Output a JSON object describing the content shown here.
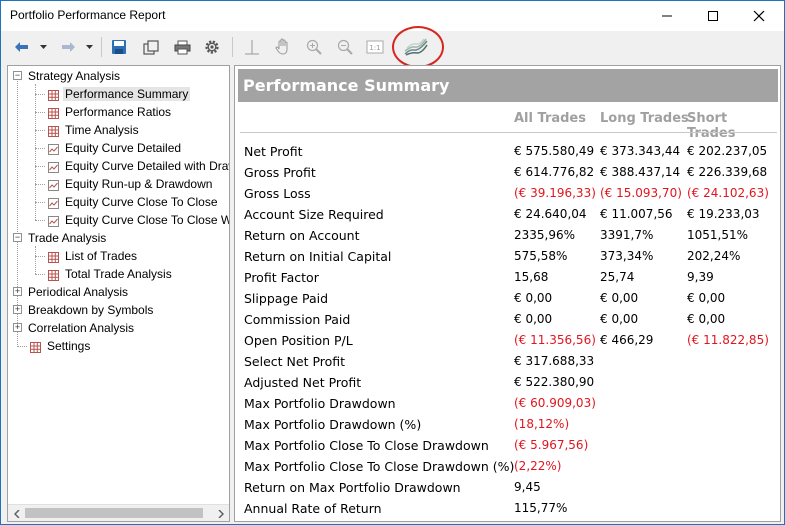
{
  "window": {
    "title": "Portfolio Performance Report"
  },
  "toolbar": {
    "icons": [
      "back-arrow-icon",
      "dropdown-icon",
      "forward-arrow-icon",
      "dropdown-icon",
      "save-icon",
      "export-icon",
      "print-icon",
      "settings-gear-icon",
      "crosshair-icon",
      "hand-pan-icon",
      "zoom-in-icon",
      "zoom-out-icon",
      "zoom-fit-icon",
      "equity-curve-icon"
    ],
    "highlight_color": "#d6261e"
  },
  "tree": {
    "items": [
      {
        "label": "Strategy Analysis",
        "type": "folder",
        "expanded": true
      },
      {
        "label": "Performance Summary",
        "type": "grid",
        "selected": true
      },
      {
        "label": "Performance Ratios",
        "type": "grid"
      },
      {
        "label": "Time Analysis",
        "type": "grid"
      },
      {
        "label": "Equity Curve Detailed",
        "type": "chart"
      },
      {
        "label": "Equity Curve Detailed with Draw",
        "type": "chart"
      },
      {
        "label": "Equity Run-up & Drawdown",
        "type": "chart"
      },
      {
        "label": "Equity Curve Close To Close",
        "type": "chart"
      },
      {
        "label": "Equity Curve Close To Close Wi",
        "type": "chart"
      },
      {
        "label": "Trade Analysis",
        "type": "folder",
        "expanded": true
      },
      {
        "label": "List of Trades",
        "type": "grid"
      },
      {
        "label": "Total Trade Analysis",
        "type": "grid"
      },
      {
        "label": "Periodical Analysis",
        "type": "folder",
        "expanded": false
      },
      {
        "label": "Breakdown by Symbols",
        "type": "folder",
        "expanded": false
      },
      {
        "label": "Correlation Analysis",
        "type": "folder",
        "expanded": false
      },
      {
        "label": "Settings",
        "type": "grid"
      }
    ]
  },
  "report": {
    "title": "Performance Summary",
    "columns": [
      "All Trades",
      "Long Trades",
      "Short Trades"
    ],
    "negative_color": "#e0161e",
    "rows": [
      {
        "label": "Net Profit",
        "all": "€ 575.580,49",
        "long": "€ 373.343,44",
        "short": "€ 202.237,05"
      },
      {
        "label": "Gross Profit",
        "all": "€ 614.776,82",
        "long": "€ 388.437,14",
        "short": "€ 226.339,68"
      },
      {
        "label": "Gross Loss",
        "all": "(€ 39.196,33)",
        "long": "(€ 15.093,70)",
        "short": "(€ 24.102,63)"
      },
      {
        "label": "Account Size Required",
        "all": "€ 24.640,04",
        "long": "€ 11.007,56",
        "short": "€ 19.233,03"
      },
      {
        "label": "Return on Account",
        "all": "2335,96%",
        "long": "3391,7%",
        "short": "1051,51%"
      },
      {
        "label": "Return on Initial Capital",
        "all": "575,58%",
        "long": "373,34%",
        "short": "202,24%"
      },
      {
        "label": "Profit Factor",
        "all": "15,68",
        "long": "25,74",
        "short": "9,39"
      },
      {
        "label": "Slippage Paid",
        "all": "€ 0,00",
        "long": "€ 0,00",
        "short": "€ 0,00"
      },
      {
        "label": "Commission Paid",
        "all": "€ 0,00",
        "long": "€ 0,00",
        "short": "€ 0,00"
      },
      {
        "label": "Open Position P/L",
        "all": "(€ 11.356,56)",
        "long": "€ 466,29",
        "short": "(€ 11.822,85)"
      },
      {
        "label": "Select Net Profit",
        "all": "€ 317.688,33",
        "long": "",
        "short": ""
      },
      {
        "label": "Adjusted Net Profit",
        "all": "€ 522.380,90",
        "long": "",
        "short": ""
      },
      {
        "label": "Max Portfolio Drawdown",
        "all": "(€ 60.909,03)",
        "long": "",
        "short": ""
      },
      {
        "label": "Max Portfolio Drawdown (%)",
        "all": "(18,12%)",
        "long": "",
        "short": ""
      },
      {
        "label": "Max Portfolio Close To Close Drawdown",
        "all": "(€ 5.967,56)",
        "long": "",
        "short": ""
      },
      {
        "label": "Max Portfolio Close To Close Drawdown (%)",
        "all": "(2,22%)",
        "long": "",
        "short": ""
      },
      {
        "label": "Return on Max Portfolio Drawdown",
        "all": "9,45",
        "long": "",
        "short": ""
      },
      {
        "label": "Annual Rate of Return",
        "all": "115,77%",
        "long": "",
        "short": ""
      }
    ]
  }
}
